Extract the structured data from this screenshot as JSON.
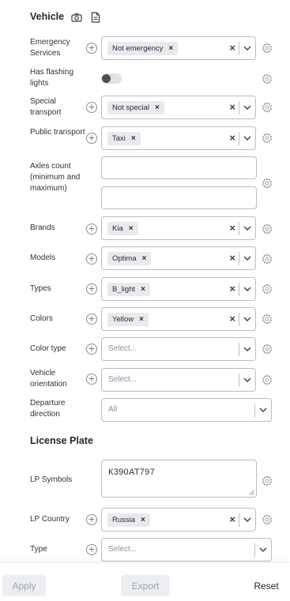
{
  "vehicle_section": {
    "title": "Vehicle",
    "icons": [
      "camera-icon",
      "document-icon"
    ]
  },
  "filters": {
    "emergency": {
      "label": "Emergency Services",
      "value": "Not emergency"
    },
    "flashing": {
      "label": "Has flashing lights",
      "toggle_on": false
    },
    "special": {
      "label": "Special transport",
      "value": "Not special"
    },
    "public": {
      "label": "Public transport",
      "value": "Taxi"
    },
    "axles": {
      "label": "Axles count (minimum and maximum)",
      "min": "",
      "max": ""
    },
    "brands": {
      "label": "Brands",
      "value": "Kia"
    },
    "models": {
      "label": "Models",
      "value": "Optima"
    },
    "types": {
      "label": "Types",
      "value": "B_light"
    },
    "colors": {
      "label": "Colors",
      "value": "Yellow"
    },
    "color_type": {
      "label": "Color type",
      "placeholder": "Select..."
    },
    "orientation": {
      "label": "Vehicle orientation",
      "placeholder": "Select..."
    },
    "departure": {
      "label": "Departure direction",
      "value": "All"
    }
  },
  "lp_section": {
    "title": "License Plate",
    "symbols": {
      "label": "LP Symbols",
      "value": "К390АТ797"
    },
    "country": {
      "label": "LP Country",
      "value": "Russia"
    },
    "type": {
      "label": "Type",
      "placeholder": "Select..."
    }
  },
  "footer": {
    "apply": "Apply",
    "export": "Export",
    "reset": "Reset"
  },
  "chip_remove_glyph": "×",
  "clear_glyph": "×",
  "colors": {
    "border": "#b9bdc4",
    "chip_bg": "#e8eaee",
    "disabled_text": "#9fa4ad"
  }
}
